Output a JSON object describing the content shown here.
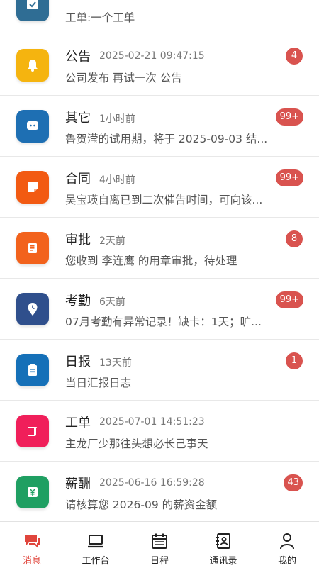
{
  "messages": [
    {
      "title": "",
      "time": "",
      "desc": "工单:一个工单",
      "badge": "",
      "color": "#2f6d94"
    },
    {
      "title": "公告",
      "time": "2025-02-21 09:47:15",
      "desc": "公司发布 再试一次 公告",
      "badge": "4",
      "color": "#f5b40f"
    },
    {
      "title": "其它",
      "time": "1小时前",
      "desc": "鲁贺滢的试用期，将于 2025-09-03 结...",
      "badge": "99+",
      "color": "#1e6fb3"
    },
    {
      "title": "合同",
      "time": "4小时前",
      "desc": "吴宝瑛自离已到二次催告时间，可向该...",
      "badge": "99+",
      "color": "#f25a12"
    },
    {
      "title": "审批",
      "time": "2天前",
      "desc": "您收到 李连鹰 的用章审批，待处理",
      "badge": "8",
      "color": "#f2621c"
    },
    {
      "title": "考勤",
      "time": "6天前",
      "desc": "07月考勤有异常记录！缺卡：1天；旷...",
      "badge": "99+",
      "color": "#2f4f8c"
    },
    {
      "title": "日报",
      "time": "13天前",
      "desc": "当日汇报日志",
      "badge": "1",
      "color": "#1570b8"
    },
    {
      "title": "工单",
      "time": "2025-07-01 14:51:23",
      "desc": "主龙厂少那往头想必长己事天",
      "badge": "",
      "color": "#f01f5a"
    },
    {
      "title": "薪酬",
      "time": "2025-06-16 16:59:28",
      "desc": "请核算您 2026-09 的薪资金额",
      "badge": "43",
      "color": "#1f9f62"
    }
  ],
  "tabs": [
    {
      "label": "消息",
      "icon": "chat-icon",
      "active": true
    },
    {
      "label": "工作台",
      "icon": "laptop-icon",
      "active": false
    },
    {
      "label": "日程",
      "icon": "calendar-icon",
      "active": false
    },
    {
      "label": "通讯录",
      "icon": "contacts-icon",
      "active": false
    },
    {
      "label": "我的",
      "icon": "person-icon",
      "active": false
    }
  ],
  "colors": {
    "accent": "#e0453c",
    "badge": "#d9534f"
  }
}
